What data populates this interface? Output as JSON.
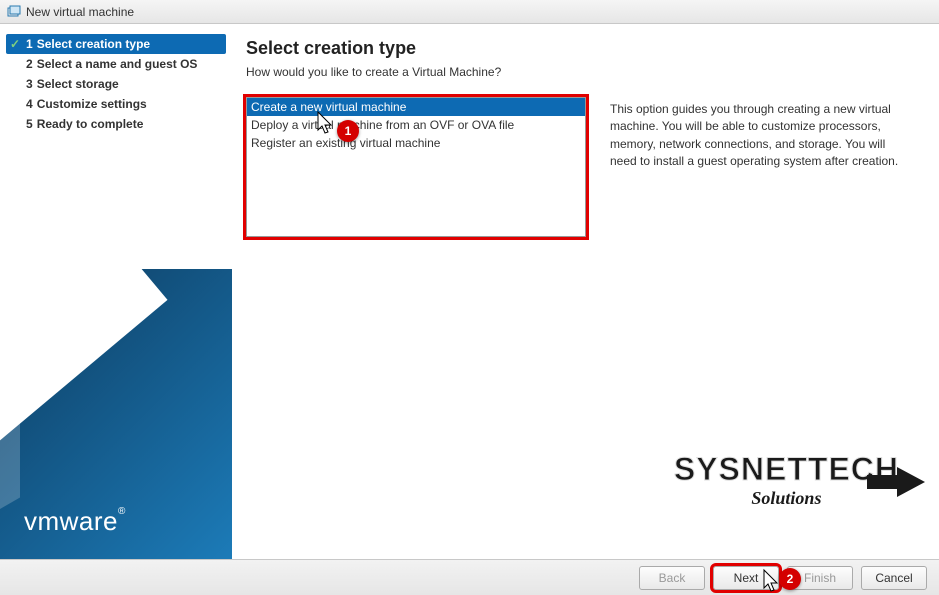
{
  "window_title": "New virtual machine",
  "sidebar": {
    "steps": [
      {
        "num": "1",
        "label": "Select creation type",
        "selected": true,
        "checked": true
      },
      {
        "num": "2",
        "label": "Select a name and guest OS",
        "selected": false,
        "checked": false
      },
      {
        "num": "3",
        "label": "Select storage",
        "selected": false,
        "checked": false
      },
      {
        "num": "4",
        "label": "Customize settings",
        "selected": false,
        "checked": false
      },
      {
        "num": "5",
        "label": "Ready to complete",
        "selected": false,
        "checked": false
      }
    ]
  },
  "brand": "vmware",
  "main": {
    "heading": "Select creation type",
    "subtitle": "How would you like to create a Virtual Machine?",
    "options": [
      {
        "label": "Create a new virtual machine",
        "selected": true
      },
      {
        "label": "Deploy a virtual machine from an OVF or OVA file",
        "selected": false
      },
      {
        "label": "Register an existing virtual machine",
        "selected": false
      }
    ],
    "description": "This option guides you through creating a new virtual machine. You will be able to customize processors, memory, network connections, and storage. You will need to install a guest operating system after creation."
  },
  "footer": {
    "back": "Back",
    "next": "Next",
    "finish": "Finish",
    "cancel": "Cancel"
  },
  "annotations": {
    "callout1": "1",
    "callout2": "2"
  },
  "watermark": {
    "line1": "SYSNETTECH",
    "line2": "Solutions"
  }
}
